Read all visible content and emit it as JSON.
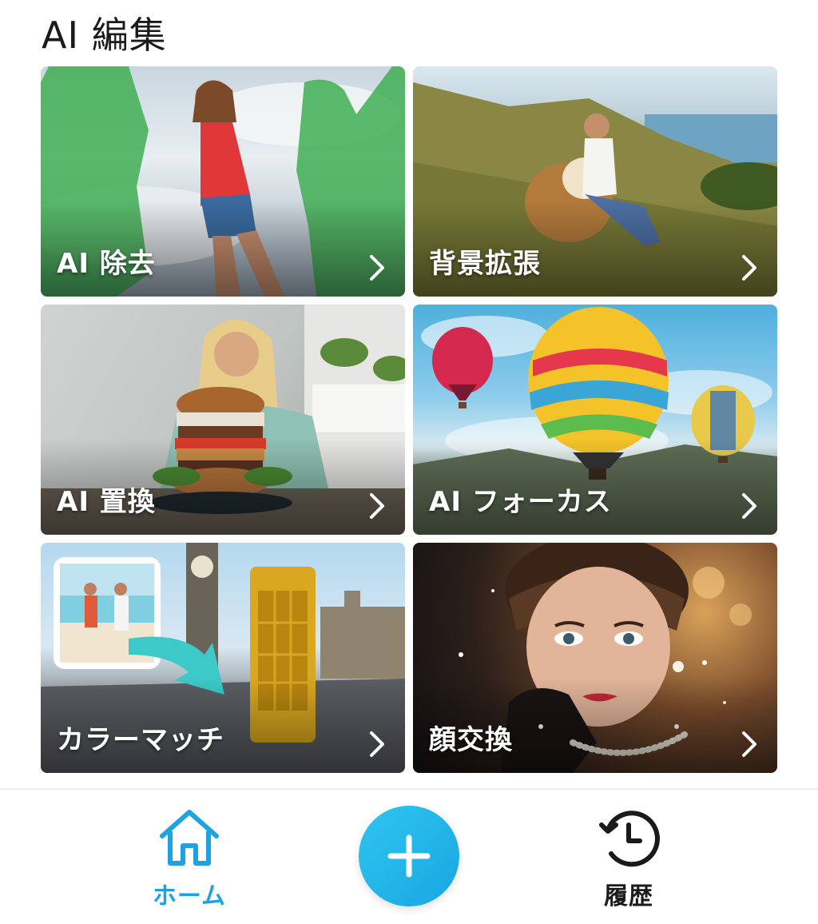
{
  "section": {
    "title": "AI 編集"
  },
  "cards": [
    {
      "label": "AI 除去",
      "icon": "chevron-right-icon"
    },
    {
      "label": "背景拡張",
      "icon": "chevron-right-icon"
    },
    {
      "label": "AI 置換",
      "icon": "chevron-right-icon"
    },
    {
      "label": "AI フォーカス",
      "icon": "chevron-right-icon"
    },
    {
      "label": "カラーマッチ",
      "icon": "chevron-right-icon"
    },
    {
      "label": "顔交換",
      "icon": "chevron-right-icon"
    }
  ],
  "bottom_nav": {
    "home": {
      "label": "ホーム",
      "icon": "home-icon",
      "active": true
    },
    "add": {
      "icon": "plus-icon"
    },
    "history": {
      "label": "履歴",
      "icon": "history-icon"
    }
  },
  "colors": {
    "accent": "#1ea3e0",
    "text": "#1a1a1a"
  }
}
